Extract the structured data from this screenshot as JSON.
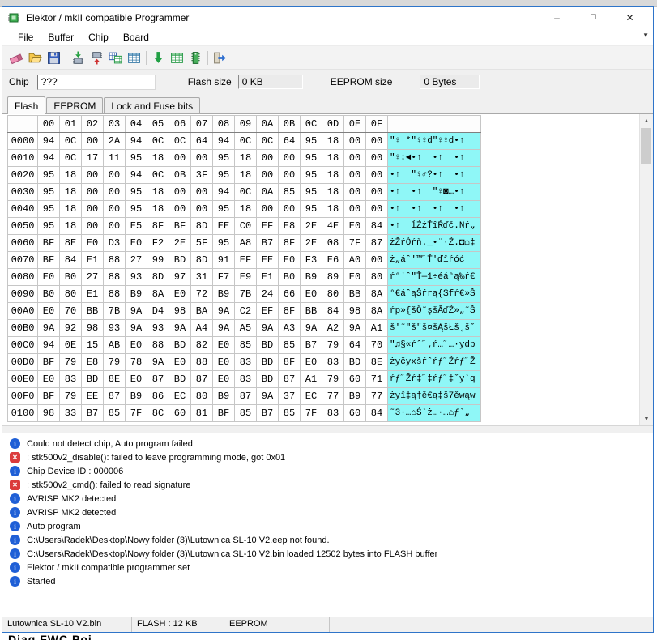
{
  "window": {
    "title": "Elektor / mkII compatible Programmer",
    "controls": {
      "minimize": "–",
      "maximize": "□",
      "close": "✕"
    }
  },
  "menu": {
    "items": [
      "File",
      "Buffer",
      "Chip",
      "Board"
    ],
    "overflow_chevron": "▼"
  },
  "toolbar": {
    "buttons": [
      {
        "name": "erase-buffer-button",
        "icon": "eraser-icon"
      },
      {
        "name": "open-file-button",
        "icon": "open-folder-icon"
      },
      {
        "name": "save-file-button",
        "icon": "save-icon"
      },
      {
        "type": "separator"
      },
      {
        "name": "write-flash-button",
        "icon": "chip-write-icon"
      },
      {
        "name": "read-flash-button",
        "icon": "chip-read-icon"
      },
      {
        "name": "verify-flash-button",
        "icon": "chip-verify-icon"
      },
      {
        "name": "compare-buffers-button",
        "icon": "buffer-grid-icon"
      },
      {
        "type": "separator"
      },
      {
        "name": "auto-program-button",
        "icon": "auto-program-icon"
      },
      {
        "name": "read-fuses-button",
        "icon": "buffer-grid2-icon"
      },
      {
        "name": "chip-detect-button",
        "icon": "chip-green-icon"
      },
      {
        "type": "separator"
      },
      {
        "name": "exit-button",
        "icon": "exit-arrow-icon"
      }
    ]
  },
  "chip_panel": {
    "chip_label": "Chip",
    "chip_value": "???",
    "flash_size_label": "Flash size",
    "flash_size_value": "0 KB",
    "eeprom_size_label": "EEPROM size",
    "eeprom_size_value": "0 Bytes"
  },
  "tabs": [
    {
      "label": "Flash",
      "active": true
    },
    {
      "label": "EEPROM",
      "active": false
    },
    {
      "label": "Lock and Fuse bits",
      "active": false
    }
  ],
  "hex_grid": {
    "columns": [
      "00",
      "01",
      "02",
      "03",
      "04",
      "05",
      "06",
      "07",
      "08",
      "09",
      "0A",
      "0B",
      "0C",
      "0D",
      "0E",
      "0F"
    ],
    "rows": [
      {
        "addr": "0000",
        "bytes": [
          "94",
          "0C",
          "00",
          "2A",
          "94",
          "0C",
          "0C",
          "64",
          "94",
          "0C",
          "0C",
          "64",
          "95",
          "18",
          "00",
          "00"
        ],
        "ascii": "\"♀ *\"♀♀d\"♀♀d•↑"
      },
      {
        "addr": "0010",
        "bytes": [
          "94",
          "0C",
          "17",
          "11",
          "95",
          "18",
          "00",
          "00",
          "95",
          "18",
          "00",
          "00",
          "95",
          "18",
          "00",
          "00"
        ],
        "ascii": "\"♀↨◄•↑  •↑  •↑"
      },
      {
        "addr": "0020",
        "bytes": [
          "95",
          "18",
          "00",
          "00",
          "94",
          "0C",
          "0B",
          "3F",
          "95",
          "18",
          "00",
          "00",
          "95",
          "18",
          "00",
          "00"
        ],
        "ascii": "•↑  \"♀♂?•↑  •↑"
      },
      {
        "addr": "0030",
        "bytes": [
          "95",
          "18",
          "00",
          "00",
          "95",
          "18",
          "00",
          "00",
          "94",
          "0C",
          "0A",
          "85",
          "95",
          "18",
          "00",
          "00"
        ],
        "ascii": "•↑  •↑  \"♀◙…•↑"
      },
      {
        "addr": "0040",
        "bytes": [
          "95",
          "18",
          "00",
          "00",
          "95",
          "18",
          "00",
          "00",
          "95",
          "18",
          "00",
          "00",
          "95",
          "18",
          "00",
          "00"
        ],
        "ascii": "•↑  •↑  •↑  •↑"
      },
      {
        "addr": "0050",
        "bytes": [
          "95",
          "18",
          "00",
          "00",
          "E5",
          "8F",
          "BF",
          "8D",
          "EE",
          "C0",
          "EF",
          "E8",
          "2E",
          "4E",
          "E0",
          "84"
        ],
        "ascii": "•↑  ĺŹżŤîŔďč.Nŕ„"
      },
      {
        "addr": "0060",
        "bytes": [
          "BF",
          "8E",
          "E0",
          "D3",
          "E0",
          "F2",
          "2E",
          "5F",
          "95",
          "A8",
          "B7",
          "8F",
          "2E",
          "08",
          "7F",
          "87"
        ],
        "ascii": "żŽŕÓŕň._•¨·Ź.◘⌂‡"
      },
      {
        "addr": "0070",
        "bytes": [
          "BF",
          "84",
          "E1",
          "88",
          "27",
          "99",
          "BD",
          "8D",
          "91",
          "EF",
          "EE",
          "E0",
          "F3",
          "E6",
          "A0",
          "00"
        ],
        "ascii": "ż„áˆ'™˝Ť'ďîŕóć"
      },
      {
        "addr": "0080",
        "bytes": [
          "E0",
          "B0",
          "27",
          "88",
          "93",
          "8D",
          "97",
          "31",
          "F7",
          "E9",
          "E1",
          "B0",
          "B9",
          "89",
          "E0",
          "80"
        ],
        "ascii": "ŕ°'ˆ\"Ť—1÷éá°ą‰ŕ€"
      },
      {
        "addr": "0090",
        "bytes": [
          "B0",
          "80",
          "E1",
          "88",
          "B9",
          "8A",
          "E0",
          "72",
          "B9",
          "7B",
          "24",
          "66",
          "E0",
          "80",
          "BB",
          "8A"
        ],
        "ascii": "°€áˆąŠŕrą{$fŕ€»Š"
      },
      {
        "addr": "00A0",
        "bytes": [
          "E0",
          "70",
          "BB",
          "7B",
          "9A",
          "D4",
          "98",
          "BA",
          "9A",
          "C2",
          "EF",
          "8F",
          "BB",
          "84",
          "98",
          "8A"
        ],
        "ascii": "ŕp»{šÔ˜şšÂďŹ»„˜Š"
      },
      {
        "addr": "00B0",
        "bytes": [
          "9A",
          "92",
          "98",
          "93",
          "9A",
          "93",
          "9A",
          "A4",
          "9A",
          "A5",
          "9A",
          "A3",
          "9A",
          "A2",
          "9A",
          "A1"
        ],
        "ascii": "š'˜\"š\"š¤šĄšŁš˛šˇ"
      },
      {
        "addr": "00C0",
        "bytes": [
          "94",
          "0E",
          "15",
          "AB",
          "E0",
          "88",
          "BD",
          "82",
          "E0",
          "85",
          "BD",
          "85",
          "B7",
          "79",
          "64",
          "70"
        ],
        "ascii": "\"♫§«ŕˆ˝‚ŕ…˝…·ydp"
      },
      {
        "addr": "00D0",
        "bytes": [
          "BF",
          "79",
          "E8",
          "79",
          "78",
          "9A",
          "E0",
          "88",
          "E0",
          "83",
          "BD",
          "8F",
          "E0",
          "83",
          "BD",
          "8E"
        ],
        "ascii": "żyčyxšŕˆŕƒ˝Źŕƒ˝Ž"
      },
      {
        "addr": "00E0",
        "bytes": [
          "E0",
          "83",
          "BD",
          "8E",
          "E0",
          "87",
          "BD",
          "87",
          "E0",
          "83",
          "BD",
          "87",
          "A1",
          "79",
          "60",
          "71"
        ],
        "ascii": "ŕƒ˝Žŕ‡˝‡ŕƒ˝‡ˇy`q"
      },
      {
        "addr": "00F0",
        "bytes": [
          "BF",
          "79",
          "EE",
          "87",
          "B9",
          "86",
          "EC",
          "80",
          "B9",
          "87",
          "9A",
          "37",
          "EC",
          "77",
          "B9",
          "77"
        ],
        "ascii": "żyî‡ą†ě€ą‡š7ěwąw"
      },
      {
        "addr": "0100",
        "bytes": [
          "98",
          "33",
          "B7",
          "85",
          "7F",
          "8C",
          "60",
          "81",
          "BF",
          "85",
          "B7",
          "85",
          "7F",
          "83",
          "60",
          "84"
        ],
        "ascii": "˜3·…⌂Ś`ż…·…⌂ƒ`„"
      }
    ]
  },
  "scrollbar": {
    "up": "▲",
    "down": "▼"
  },
  "log": {
    "icon_glyphs": {
      "info": "i",
      "error": "✕"
    },
    "entries": [
      {
        "type": "info",
        "text": "Could not detect chip, Auto program failed"
      },
      {
        "type": "error",
        "text": ": stk500v2_disable(): failed to leave programming mode, got 0x01"
      },
      {
        "type": "info",
        "text": "Chip Device ID : 000006"
      },
      {
        "type": "error",
        "text": ": stk500v2_cmd(): failed to read signature"
      },
      {
        "type": "info",
        "text": "AVRISP MK2 detected"
      },
      {
        "type": "info",
        "text": "AVRISP MK2 detected"
      },
      {
        "type": "info",
        "text": "Auto program"
      },
      {
        "type": "info",
        "text": "C:\\Users\\Radek\\Desktop\\Nowy folder (3)\\Lutownica SL-10 V2.eep not found."
      },
      {
        "type": "info",
        "text": "C:\\Users\\Radek\\Desktop\\Nowy folder (3)\\Lutownica SL-10 V2.bin loaded 12502 bytes into FLASH buffer"
      },
      {
        "type": "info",
        "text": "Elektor / mkII compatible programmer set"
      },
      {
        "type": "info",
        "text": "Started"
      }
    ]
  },
  "status_bar": {
    "panels": [
      "Lutownica SL-10 V2.bin",
      "FLASH : 12 KB",
      "EEPROM"
    ]
  },
  "background": {
    "partial_bottom_text": "Diag FWC  Poi"
  },
  "colors": {
    "window_border": "#2e74c9",
    "ascii_bg": "#8ff7f7",
    "info_icon": "#1f5fd6",
    "error_icon": "#db3b3b"
  }
}
